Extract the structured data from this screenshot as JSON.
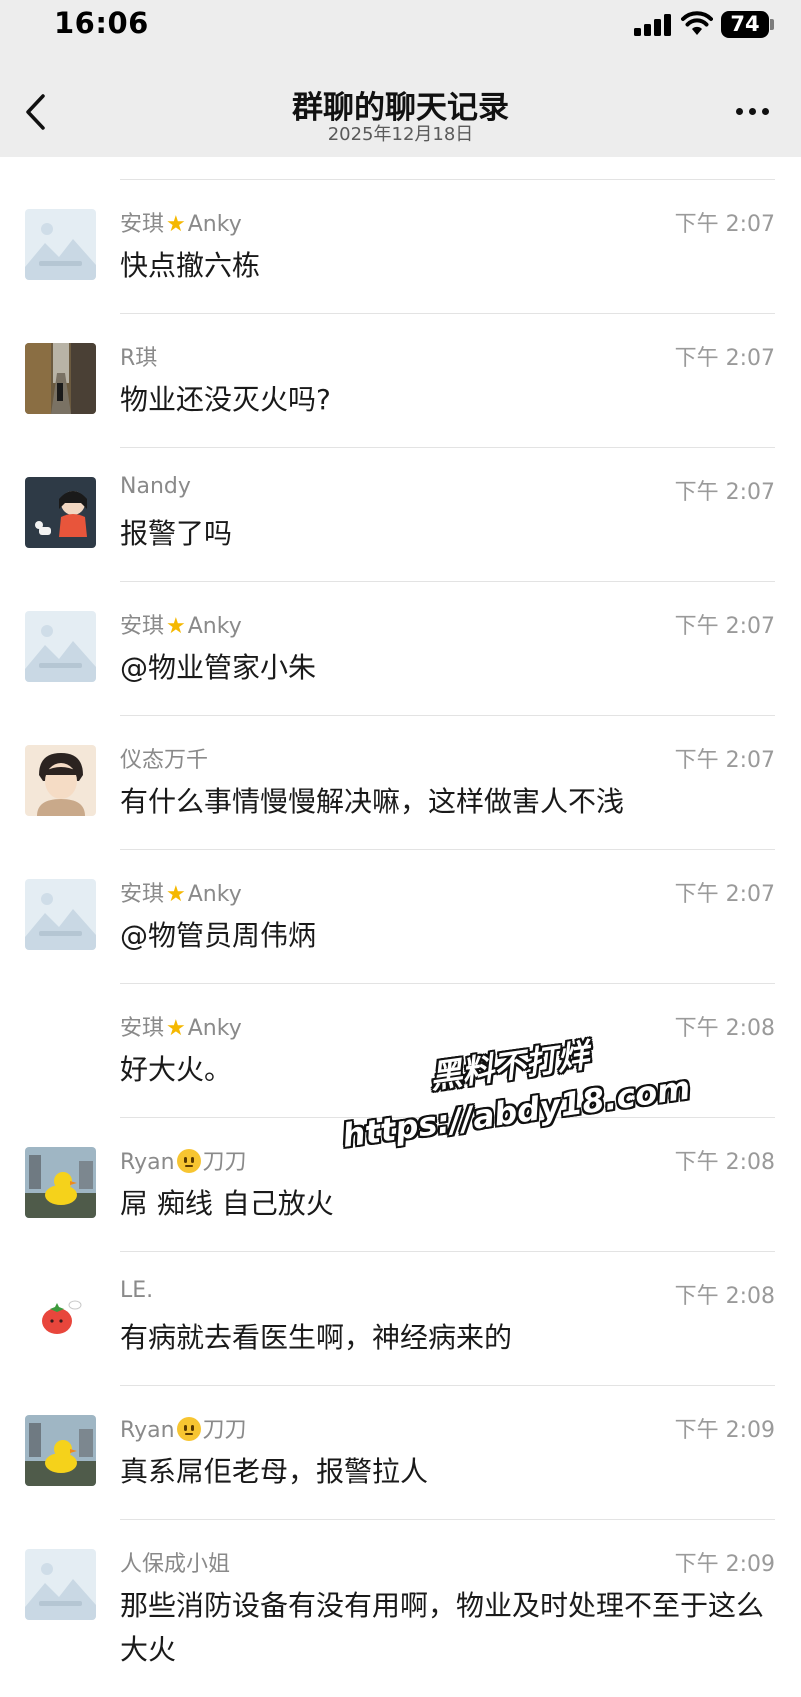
{
  "status_bar": {
    "time": "16:06",
    "battery": "74"
  },
  "nav": {
    "title": "群聊的聊天记录",
    "date": "2025年12月18日"
  },
  "messages": [
    {
      "sender": "安琪",
      "sender_suffix": "Anky",
      "time": "下午 2:07",
      "text": "快点撤六栋",
      "avatar": "placeholder-mountain-image"
    },
    {
      "sender": "R琪",
      "time": "下午 2:07",
      "text": "物业还没灭火吗?",
      "avatar": "alley-photo"
    },
    {
      "sender": "Nandy",
      "time": "下午 2:07",
      "text": "报警了吗",
      "avatar": "cartoon-girl-dog"
    },
    {
      "sender": "安琪",
      "sender_suffix": "Anky",
      "time": "下午 2:07",
      "text": "@物业管家小朱",
      "avatar": "placeholder-mountain-image"
    },
    {
      "sender": "仪态万千",
      "time": "下午 2:07",
      "text": "有什么事情慢慢解决嘛，这样做害人不浅",
      "avatar": "cartoon-boy-portrait"
    },
    {
      "sender": "安琪",
      "sender_suffix": "Anky",
      "time": "下午 2:07",
      "text": "@物管员周伟炳",
      "avatar": "placeholder-mountain-image"
    },
    {
      "sender": "安琪",
      "sender_suffix": "Anky",
      "time": "下午 2:08",
      "text": "好大火。",
      "avatar": "none"
    },
    {
      "sender": "Ryan",
      "sender_suffix": "刀刀",
      "time": "下午 2:08",
      "text": "屌 痴线 自己放火",
      "avatar": "rubber-duck-photo"
    },
    {
      "sender": "LE.",
      "time": "下午 2:08",
      "text": "有病就去看医生啊，神经病来的",
      "avatar": "tomato-cartoon"
    },
    {
      "sender": "Ryan",
      "sender_suffix": "刀刀",
      "time": "下午 2:09",
      "text": "真系屌佢老母，报警拉人",
      "avatar": "rubber-duck-photo"
    },
    {
      "sender": "人保成小姐",
      "time": "下午 2:09",
      "text": "那些消防设备有没有用啊，物业及时处理不至于这么大火",
      "avatar": "placeholder-mountain-image"
    }
  ],
  "watermark": {
    "line1": "黑料不打烊",
    "line2": "https://abdy18.com"
  }
}
